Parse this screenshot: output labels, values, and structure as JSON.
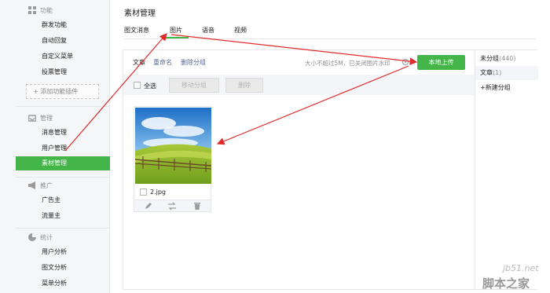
{
  "sidebar": {
    "groups": [
      {
        "title": "功能",
        "icon": "grid-icon",
        "items": [
          "群发功能",
          "自动回复",
          "自定义菜单",
          "投票管理"
        ],
        "add": "+ 添加功能插件"
      },
      {
        "title": "管理",
        "icon": "inbox-icon",
        "items": [
          "消息管理",
          "用户管理",
          "素材管理"
        ]
      },
      {
        "title": "推广",
        "icon": "megaphone-icon",
        "items": [
          "广告主",
          "流量主"
        ]
      },
      {
        "title": "统计",
        "icon": "pie-chart-icon",
        "items": [
          "用户分析",
          "图文分析",
          "菜单分析"
        ]
      }
    ],
    "active_item": "素材管理"
  },
  "main": {
    "title": "素材管理",
    "tabs": [
      "图文消息",
      "图片",
      "语音",
      "视频"
    ],
    "active_tab": "图片",
    "toolbar": {
      "group_name": "文章",
      "rename": "重命名",
      "delete_group": "删除分组",
      "hint": "大小不超过5M，已关闭图片水印",
      "upload": "本地上传"
    },
    "actions": {
      "select_all": "全选",
      "move_group": "移动分组",
      "delete": "删除"
    },
    "images": [
      {
        "name": "2.jpg"
      }
    ],
    "groups_panel": [
      {
        "name": "未分组",
        "count": "(440)"
      },
      {
        "name": "文章",
        "count": "(1)"
      },
      {
        "name": "+新建分组",
        "count": ""
      }
    ]
  },
  "watermark": {
    "line1": "jb51.net",
    "line2": "脚本之家"
  },
  "colors": {
    "accent": "#44b549",
    "link": "#576b95",
    "annotation_arrow": "#e02b2b"
  }
}
